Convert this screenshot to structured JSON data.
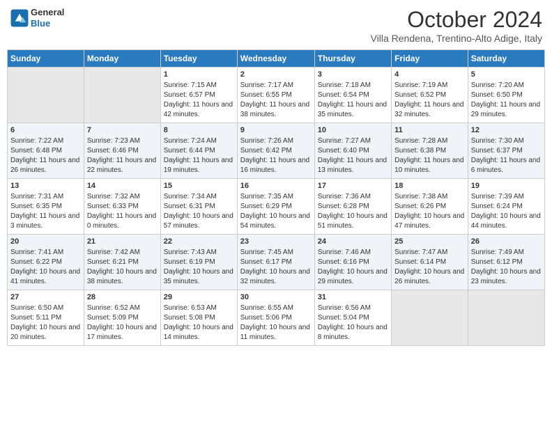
{
  "header": {
    "logo_line1": "General",
    "logo_line2": "Blue",
    "main_title": "October 2024",
    "subtitle": "Villa Rendena, Trentino-Alto Adige, Italy"
  },
  "weekdays": [
    "Sunday",
    "Monday",
    "Tuesday",
    "Wednesday",
    "Thursday",
    "Friday",
    "Saturday"
  ],
  "weeks": [
    [
      {
        "day": "",
        "sunrise": "",
        "sunset": "",
        "daylight": ""
      },
      {
        "day": "",
        "sunrise": "",
        "sunset": "",
        "daylight": ""
      },
      {
        "day": "1",
        "sunrise": "Sunrise: 7:15 AM",
        "sunset": "Sunset: 6:57 PM",
        "daylight": "Daylight: 11 hours and 42 minutes."
      },
      {
        "day": "2",
        "sunrise": "Sunrise: 7:17 AM",
        "sunset": "Sunset: 6:55 PM",
        "daylight": "Daylight: 11 hours and 38 minutes."
      },
      {
        "day": "3",
        "sunrise": "Sunrise: 7:18 AM",
        "sunset": "Sunset: 6:54 PM",
        "daylight": "Daylight: 11 hours and 35 minutes."
      },
      {
        "day": "4",
        "sunrise": "Sunrise: 7:19 AM",
        "sunset": "Sunset: 6:52 PM",
        "daylight": "Daylight: 11 hours and 32 minutes."
      },
      {
        "day": "5",
        "sunrise": "Sunrise: 7:20 AM",
        "sunset": "Sunset: 6:50 PM",
        "daylight": "Daylight: 11 hours and 29 minutes."
      }
    ],
    [
      {
        "day": "6",
        "sunrise": "Sunrise: 7:22 AM",
        "sunset": "Sunset: 6:48 PM",
        "daylight": "Daylight: 11 hours and 26 minutes."
      },
      {
        "day": "7",
        "sunrise": "Sunrise: 7:23 AM",
        "sunset": "Sunset: 6:46 PM",
        "daylight": "Daylight: 11 hours and 22 minutes."
      },
      {
        "day": "8",
        "sunrise": "Sunrise: 7:24 AM",
        "sunset": "Sunset: 6:44 PM",
        "daylight": "Daylight: 11 hours and 19 minutes."
      },
      {
        "day": "9",
        "sunrise": "Sunrise: 7:26 AM",
        "sunset": "Sunset: 6:42 PM",
        "daylight": "Daylight: 11 hours and 16 minutes."
      },
      {
        "day": "10",
        "sunrise": "Sunrise: 7:27 AM",
        "sunset": "Sunset: 6:40 PM",
        "daylight": "Daylight: 11 hours and 13 minutes."
      },
      {
        "day": "11",
        "sunrise": "Sunrise: 7:28 AM",
        "sunset": "Sunset: 6:38 PM",
        "daylight": "Daylight: 11 hours and 10 minutes."
      },
      {
        "day": "12",
        "sunrise": "Sunrise: 7:30 AM",
        "sunset": "Sunset: 6:37 PM",
        "daylight": "Daylight: 11 hours and 6 minutes."
      }
    ],
    [
      {
        "day": "13",
        "sunrise": "Sunrise: 7:31 AM",
        "sunset": "Sunset: 6:35 PM",
        "daylight": "Daylight: 11 hours and 3 minutes."
      },
      {
        "day": "14",
        "sunrise": "Sunrise: 7:32 AM",
        "sunset": "Sunset: 6:33 PM",
        "daylight": "Daylight: 11 hours and 0 minutes."
      },
      {
        "day": "15",
        "sunrise": "Sunrise: 7:34 AM",
        "sunset": "Sunset: 6:31 PM",
        "daylight": "Daylight: 10 hours and 57 minutes."
      },
      {
        "day": "16",
        "sunrise": "Sunrise: 7:35 AM",
        "sunset": "Sunset: 6:29 PM",
        "daylight": "Daylight: 10 hours and 54 minutes."
      },
      {
        "day": "17",
        "sunrise": "Sunrise: 7:36 AM",
        "sunset": "Sunset: 6:28 PM",
        "daylight": "Daylight: 10 hours and 51 minutes."
      },
      {
        "day": "18",
        "sunrise": "Sunrise: 7:38 AM",
        "sunset": "Sunset: 6:26 PM",
        "daylight": "Daylight: 10 hours and 47 minutes."
      },
      {
        "day": "19",
        "sunrise": "Sunrise: 7:39 AM",
        "sunset": "Sunset: 6:24 PM",
        "daylight": "Daylight: 10 hours and 44 minutes."
      }
    ],
    [
      {
        "day": "20",
        "sunrise": "Sunrise: 7:41 AM",
        "sunset": "Sunset: 6:22 PM",
        "daylight": "Daylight: 10 hours and 41 minutes."
      },
      {
        "day": "21",
        "sunrise": "Sunrise: 7:42 AM",
        "sunset": "Sunset: 6:21 PM",
        "daylight": "Daylight: 10 hours and 38 minutes."
      },
      {
        "day": "22",
        "sunrise": "Sunrise: 7:43 AM",
        "sunset": "Sunset: 6:19 PM",
        "daylight": "Daylight: 10 hours and 35 minutes."
      },
      {
        "day": "23",
        "sunrise": "Sunrise: 7:45 AM",
        "sunset": "Sunset: 6:17 PM",
        "daylight": "Daylight: 10 hours and 32 minutes."
      },
      {
        "day": "24",
        "sunrise": "Sunrise: 7:46 AM",
        "sunset": "Sunset: 6:16 PM",
        "daylight": "Daylight: 10 hours and 29 minutes."
      },
      {
        "day": "25",
        "sunrise": "Sunrise: 7:47 AM",
        "sunset": "Sunset: 6:14 PM",
        "daylight": "Daylight: 10 hours and 26 minutes."
      },
      {
        "day": "26",
        "sunrise": "Sunrise: 7:49 AM",
        "sunset": "Sunset: 6:12 PM",
        "daylight": "Daylight: 10 hours and 23 minutes."
      }
    ],
    [
      {
        "day": "27",
        "sunrise": "Sunrise: 6:50 AM",
        "sunset": "Sunset: 5:11 PM",
        "daylight": "Daylight: 10 hours and 20 minutes."
      },
      {
        "day": "28",
        "sunrise": "Sunrise: 6:52 AM",
        "sunset": "Sunset: 5:09 PM",
        "daylight": "Daylight: 10 hours and 17 minutes."
      },
      {
        "day": "29",
        "sunrise": "Sunrise: 6:53 AM",
        "sunset": "Sunset: 5:08 PM",
        "daylight": "Daylight: 10 hours and 14 minutes."
      },
      {
        "day": "30",
        "sunrise": "Sunrise: 6:55 AM",
        "sunset": "Sunset: 5:06 PM",
        "daylight": "Daylight: 10 hours and 11 minutes."
      },
      {
        "day": "31",
        "sunrise": "Sunrise: 6:56 AM",
        "sunset": "Sunset: 5:04 PM",
        "daylight": "Daylight: 10 hours and 8 minutes."
      },
      {
        "day": "",
        "sunrise": "",
        "sunset": "",
        "daylight": ""
      },
      {
        "day": "",
        "sunrise": "",
        "sunset": "",
        "daylight": ""
      }
    ]
  ]
}
